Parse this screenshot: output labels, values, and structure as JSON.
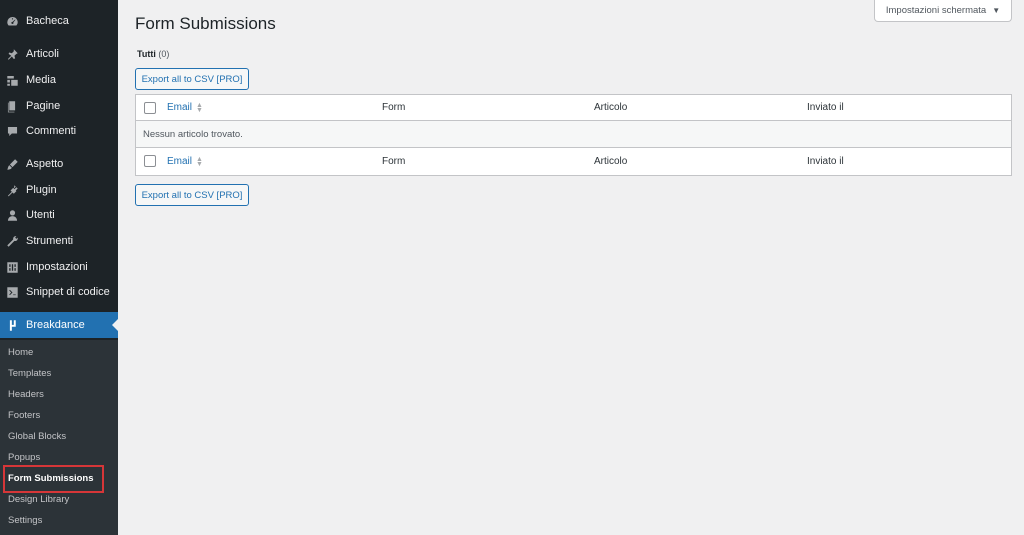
{
  "sidebar": {
    "items": [
      {
        "label": "Bacheca",
        "icon": "dashboard-icon"
      },
      {
        "label": "Articoli",
        "icon": "pin-icon"
      },
      {
        "label": "Media",
        "icon": "media-icon"
      },
      {
        "label": "Pagine",
        "icon": "pages-icon"
      },
      {
        "label": "Commenti",
        "icon": "comments-icon"
      },
      {
        "label": "Aspetto",
        "icon": "appearance-icon"
      },
      {
        "label": "Plugin",
        "icon": "plugin-icon"
      },
      {
        "label": "Utenti",
        "icon": "users-icon"
      },
      {
        "label": "Strumenti",
        "icon": "tools-icon"
      },
      {
        "label": "Impostazioni",
        "icon": "settings-icon"
      },
      {
        "label": "Snippet di codice",
        "icon": "code-snippets-icon"
      }
    ],
    "active": {
      "label": "Breakdance",
      "icon": "breakdance-icon"
    },
    "submenu": [
      "Home",
      "Templates",
      "Headers",
      "Footers",
      "Global Blocks",
      "Popups",
      "Form Submissions",
      "Design Library",
      "Settings"
    ],
    "current_submenu": "Form Submissions"
  },
  "screen_options": {
    "label": "Impostazioni schermata"
  },
  "page": {
    "title": "Form Submissions",
    "filter_label": "Tutti",
    "filter_count": "(0)",
    "export_label": "Export all to CSV [PRO]"
  },
  "table": {
    "columns": [
      "Email",
      "Form",
      "Articolo",
      "Inviato il"
    ],
    "empty_message": "Nessun articolo trovato."
  },
  "colors": {
    "sidebar_bg": "#1d2327",
    "accent": "#2271b1",
    "highlight": "#d63638"
  }
}
